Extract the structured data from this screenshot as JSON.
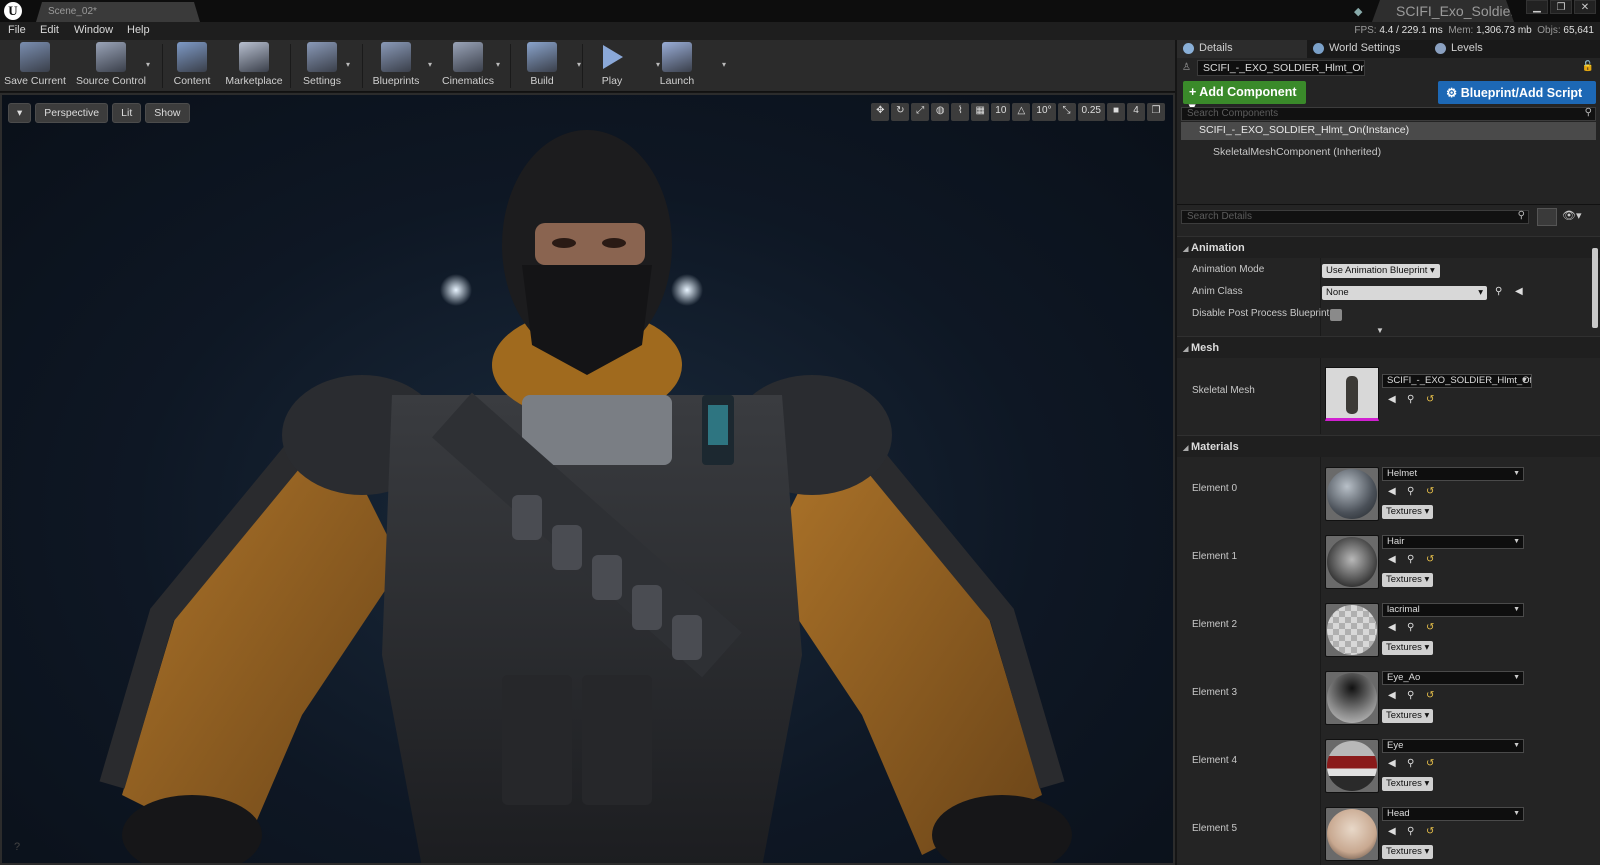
{
  "titlebar": {
    "scene_tab": "Scene_02*",
    "project_tab": "SCIFI_Exo_Soldier",
    "window_buttons": [
      "▁",
      "❐",
      "✕"
    ]
  },
  "menu": [
    "File",
    "Edit",
    "Window",
    "Help"
  ],
  "stats": {
    "fps_label": "FPS:",
    "fps": "4.4",
    "ms": "/ 229.1 ms",
    "mem_label": "Mem:",
    "mem": "1,306.73 mb",
    "objs_label": "Objs:",
    "objs": "65,641"
  },
  "toolbar": [
    {
      "label": "Save Current",
      "icon": "save-icon",
      "color": "#7a8eb0"
    },
    {
      "label": "Source Control",
      "icon": "source-control-icon",
      "color": "#9aa4b8"
    },
    {
      "label": "Content",
      "icon": "content-icon",
      "color": "#7e9ac6"
    },
    {
      "label": "Marketplace",
      "icon": "marketplace-icon",
      "color": "#b8c0d0"
    },
    {
      "label": "Settings",
      "icon": "settings-icon",
      "color": "#8a9ab8"
    },
    {
      "label": "Blueprints",
      "icon": "blueprints-icon",
      "color": "#8a9ab8"
    },
    {
      "label": "Cinematics",
      "icon": "cinematics-icon",
      "color": "#9aa4b8"
    },
    {
      "label": "Build",
      "icon": "build-icon",
      "color": "#8aa4cc"
    },
    {
      "label": "Play",
      "icon": "play-icon",
      "color": "#8aa8d8"
    },
    {
      "label": "Launch",
      "icon": "launch-icon",
      "color": "#9aaed8"
    }
  ],
  "viewport": {
    "perspective": "Perspective",
    "lit": "Lit",
    "show": "Show",
    "right_controls": [
      "10",
      "10°",
      "0.25",
      "4"
    ]
  },
  "panel": {
    "tabs": [
      "Details",
      "World Settings",
      "Levels"
    ],
    "actor_name": "SCIFI_-_EXO_SOLDIER_Hlmt_On",
    "add_component": "+ Add Component ▾",
    "blueprint_script": "Blueprint/Add Script",
    "search_components_placeholder": "Search Components",
    "selected_component": "SCIFI_-_EXO_SOLDIER_Hlmt_On(Instance)",
    "child_component": "SkeletalMeshComponent (Inherited)",
    "search_details_placeholder": "Search Details",
    "animation": {
      "header": "Animation",
      "mode_label": "Animation Mode",
      "mode_value": "Use Animation Blueprint",
      "class_label": "Anim Class",
      "class_value": "None",
      "disable_label": "Disable Post Process Blueprint"
    },
    "mesh": {
      "header": "Mesh",
      "label": "Skeletal Mesh",
      "value": "SCIFI_-_EXO_SOLDIER_Hlmt_Off"
    },
    "materials": {
      "header": "Materials",
      "textures_label": "Textures",
      "elements": [
        {
          "label": "Element 0",
          "value": "Helmet"
        },
        {
          "label": "Element 1",
          "value": "Hair"
        },
        {
          "label": "Element 2",
          "value": "lacrimal"
        },
        {
          "label": "Element 3",
          "value": "Eye_Ao"
        },
        {
          "label": "Element 4",
          "value": "Eye"
        },
        {
          "label": "Element 5",
          "value": "Head"
        }
      ]
    }
  }
}
